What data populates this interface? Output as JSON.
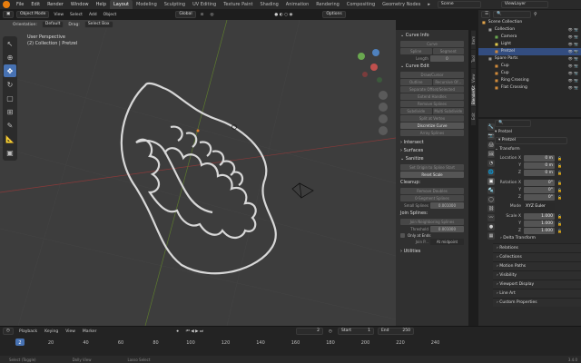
{
  "menu": [
    "File",
    "Edit",
    "Render",
    "Window",
    "Help"
  ],
  "workspaces": [
    "Layout",
    "Modeling",
    "Sculpting",
    "UV Editing",
    "Texture Paint",
    "Shading",
    "Animation",
    "Rendering",
    "Compositing",
    "Geometry Nodes"
  ],
  "active_workspace": "Layout",
  "scene": "Scene",
  "view_layer": "ViewLayer",
  "viewport_header": {
    "mode": "Object Mode",
    "menus": [
      "View",
      "Select",
      "Add",
      "Object"
    ],
    "transform": "Global",
    "options": "Options"
  },
  "viewport_header2": {
    "orientation_label": "Orientation:",
    "orientation": "Default",
    "drag_label": "Drag:",
    "drag": "Select Box"
  },
  "viewport_label": {
    "line1": "User Perspective",
    "line2": "(2) Collection | Pretzel"
  },
  "npanel": {
    "curve_info": "Curve Info",
    "curve_label": "Curve",
    "spline_label": "Spline",
    "segment_label": "Segment",
    "length_label": "Length",
    "length_value": "0",
    "curve_edit": "Curve Edit",
    "btns": [
      "Draw/Cursor",
      "Outline",
      "Recursive Of...",
      "Separate Offset/Selected",
      "Extend Handles",
      "Remove Splines",
      "Subdivide",
      "Multi Subdivide",
      "Split at Vertex",
      "Discretize Curve",
      "Array Splines"
    ],
    "intersect": "Intersect",
    "surfaces": "Surfaces",
    "sanitize": "Sanitize",
    "sanitize_btn1": "Set Origin to Spline Start",
    "reset_scale": "Reset Scale",
    "cleanup": "Cleanup:",
    "remove_doubles": "Remove Doubles",
    "zero_segment": "0-Segment Splines",
    "small_splines": "Small Splines",
    "small_value": "0.001000",
    "join_splines": "Join Splines:",
    "join_neighboring": "Join Neighboring Splines",
    "threshold": "Threshold",
    "threshold_value": "0.001000",
    "only_at_ends": "Only at Ends",
    "join_p": "Join P...",
    "at_midpoint": "At midpoint",
    "utilities": "Utilities"
  },
  "ntabs": [
    "Item",
    "Tool",
    "View",
    "BlenderKit",
    "Edit"
  ],
  "outliner": {
    "items": [
      {
        "label": "Scene Collection",
        "indent": 0
      },
      {
        "label": "Collection",
        "indent": 1
      },
      {
        "label": "Camera",
        "indent": 2
      },
      {
        "label": "Light",
        "indent": 2
      },
      {
        "label": "Pretzel",
        "indent": 2
      },
      {
        "label": "Spare Parts",
        "indent": 1
      },
      {
        "label": "Cup",
        "indent": 2
      },
      {
        "label": "Cup",
        "indent": 2
      },
      {
        "label": "Ring Crossing",
        "indent": 2
      },
      {
        "label": "Flat Crossing",
        "indent": 2
      }
    ]
  },
  "properties": {
    "breadcrumb": "Pretzel",
    "object_name": "Pretzel",
    "transform": "Transform",
    "location_label": "Location X",
    "loc": [
      "0 m",
      "0 m",
      "0 m"
    ],
    "rotation_label": "Rotation X",
    "rot": [
      "0°",
      "0°",
      "0°"
    ],
    "mode_label": "Mode",
    "mode": "XYZ Euler",
    "scale_label": "Scale X",
    "scale": [
      "1.000",
      "1.000",
      "1.000"
    ],
    "y": "Y",
    "z": "Z",
    "delta": "Delta Transform",
    "sections": [
      "Relations",
      "Collections",
      "Motion Paths",
      "Visibility",
      "Viewport Display",
      "Line Art",
      "Custom Properties"
    ]
  },
  "timeline": {
    "menus": [
      "Playback",
      "Keying",
      "View",
      "Marker"
    ],
    "current_frame": "2",
    "start_label": "Start",
    "start": "1",
    "end_label": "End",
    "end": "250",
    "ticks": [
      "2",
      "20",
      "40",
      "60",
      "80",
      "100",
      "120",
      "140",
      "160",
      "180",
      "200",
      "220",
      "240"
    ]
  },
  "status": {
    "select": "Select (Toggle)",
    "dolly": "Dolly View",
    "lasso": "Lasso Select",
    "version": "3.4.0"
  }
}
